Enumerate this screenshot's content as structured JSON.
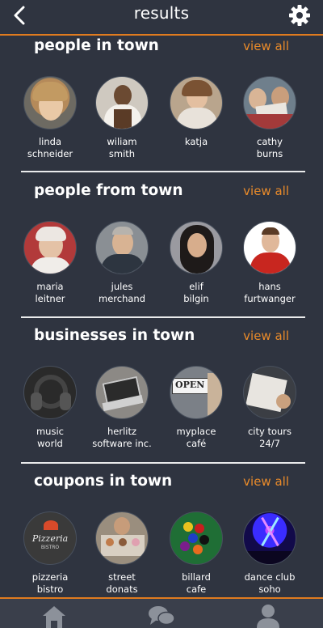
{
  "header": {
    "title": "results",
    "back_icon": "chevron-left-icon",
    "settings_icon": "gear-icon"
  },
  "accent_color": "#e07b1f",
  "sections": [
    {
      "title": "people in town",
      "view_all": "view all",
      "items": [
        {
          "name": "linda\nschneider"
        },
        {
          "name": "wiliam\nsmith"
        },
        {
          "name": "katja"
        },
        {
          "name": "cathy\nburns"
        }
      ]
    },
    {
      "title": "people from town",
      "view_all": "view all",
      "items": [
        {
          "name": "maria\nleitner"
        },
        {
          "name": "jules\nmerchand"
        },
        {
          "name": "elif\nbilgin"
        },
        {
          "name": "hans\nfurtwanger"
        }
      ]
    },
    {
      "title": "businesses in town",
      "view_all": "view all",
      "items": [
        {
          "name": "music\nworld"
        },
        {
          "name": "herlitz\nsoftware inc."
        },
        {
          "name": "myplace\ncafé"
        },
        {
          "name": "city tours\n24/7"
        }
      ]
    },
    {
      "title": "coupons in town",
      "view_all": "view all",
      "items": [
        {
          "name": "pizzeria\nbistro",
          "logo_text": "Pizzeria",
          "logo_sub": "BISTRO"
        },
        {
          "name": "street\ndonats"
        },
        {
          "name": "billard\ncafe"
        },
        {
          "name": "dance club\nsoho"
        }
      ]
    }
  ],
  "bottom_nav": {
    "items": [
      {
        "icon": "home-icon"
      },
      {
        "icon": "chat-icon"
      },
      {
        "icon": "profile-icon"
      }
    ]
  }
}
